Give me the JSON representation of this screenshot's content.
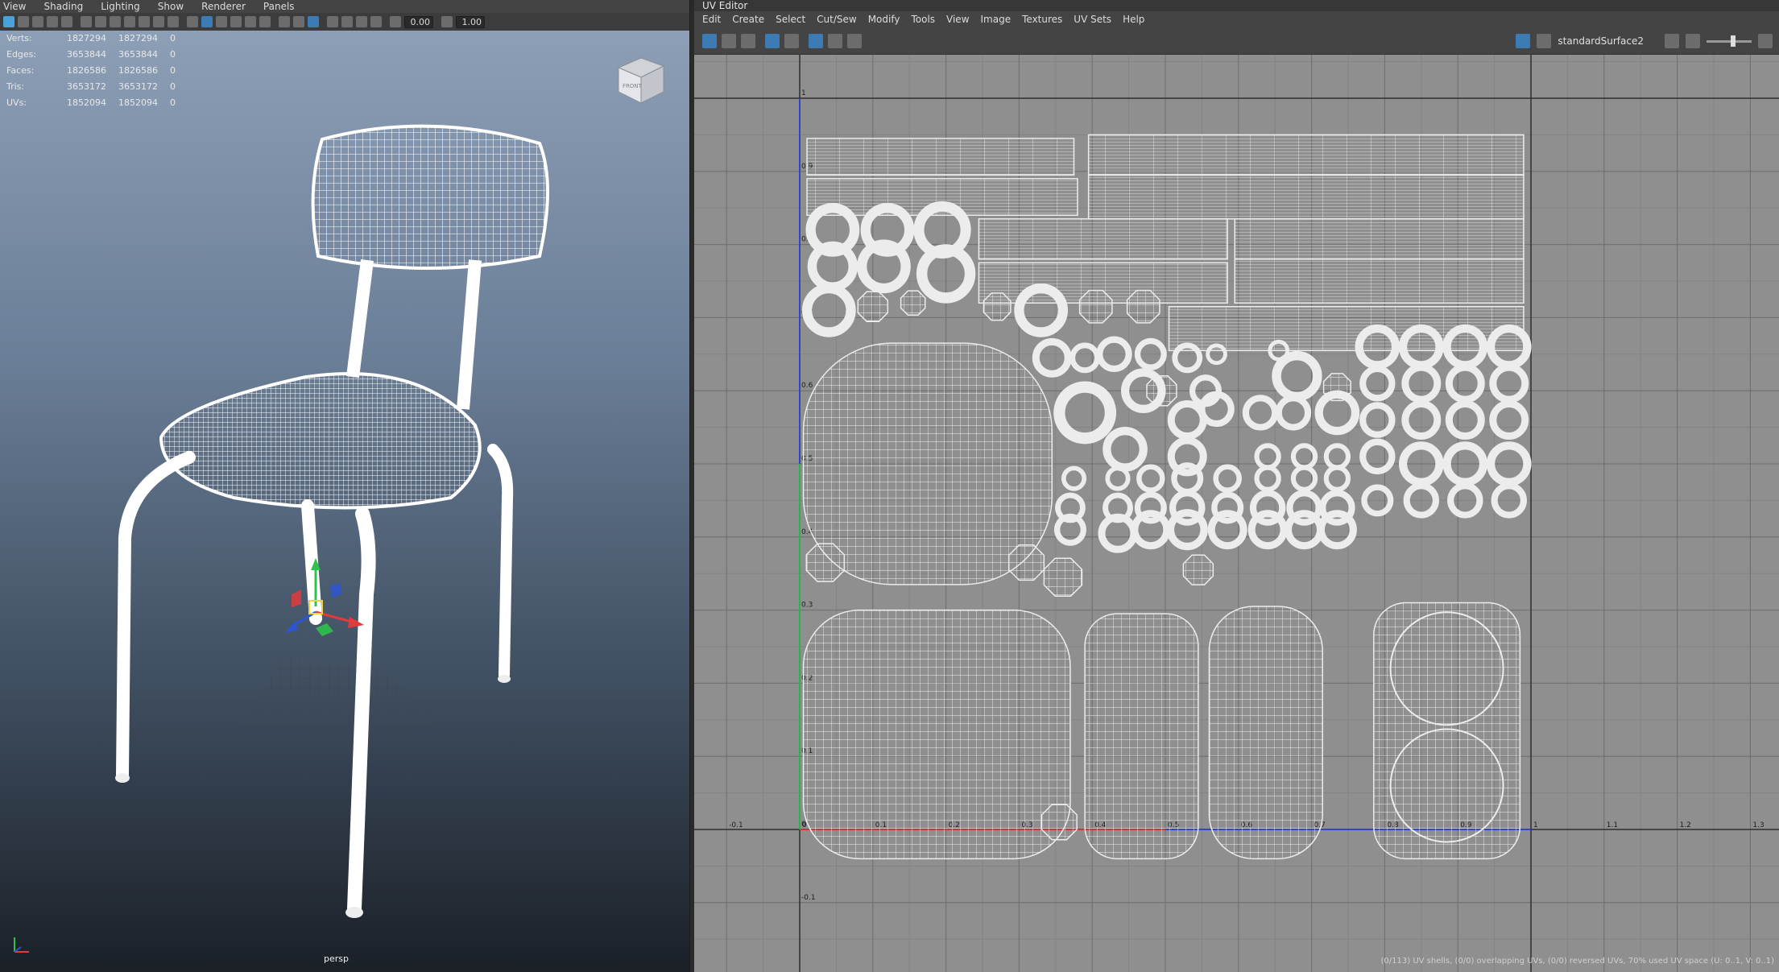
{
  "viewport": {
    "menu": [
      "View",
      "Shading",
      "Lighting",
      "Show",
      "Renderer",
      "Panels"
    ],
    "toolbar": {
      "field_a": "0.00",
      "field_b": "1.00"
    },
    "hud": [
      {
        "label": "Verts:",
        "v1": "1827294",
        "v2": "1827294",
        "v3": "0"
      },
      {
        "label": "Edges:",
        "v1": "3653844",
        "v2": "3653844",
        "v3": "0"
      },
      {
        "label": "Faces:",
        "v1": "1826586",
        "v2": "1826586",
        "v3": "0"
      },
      {
        "label": "Tris:",
        "v1": "3653172",
        "v2": "3653172",
        "v3": "0"
      },
      {
        "label": "UVs:",
        "v1": "1852094",
        "v2": "1852094",
        "v3": "0"
      }
    ],
    "viewcube_label": "FRONT",
    "camera_label": "persp",
    "colors": {
      "sky_top": "#8d9fb6",
      "sky_bottom": "#1b2027",
      "wire": "#ffffff",
      "axis_x": "#e23b3b",
      "axis_y": "#2fc14d",
      "axis_z": "#2c55d6",
      "manip_center": "#f2d33c"
    }
  },
  "uv_editor": {
    "title": "UV Editor",
    "menu": [
      "Edit",
      "Create",
      "Select",
      "Cut/Sew",
      "Modify",
      "Tools",
      "View",
      "Image",
      "Textures",
      "UV Sets",
      "Help"
    ],
    "shader_name": "standardSurface2",
    "u_ticks": [
      "-0.1",
      "0",
      "0.1",
      "0.2",
      "0.3",
      "0.4",
      "0.5",
      "0.6",
      "0.7",
      "0.8",
      "0.9",
      "1",
      "1.1",
      "1.2",
      "1.3"
    ],
    "v_ticks": [
      "1",
      "0.9",
      "0.8",
      "0.7",
      "0.6",
      "0.5",
      "0.4",
      "0.3",
      "0.2",
      "0.1",
      "0",
      "-0.1"
    ],
    "status": "(0/113) UV shells, (0/0) overlapping UVs, (0/0) reversed UVs, 70% used UV space (U: 0..1, V: 0..1)",
    "colors": {
      "background": "#8f8f8f",
      "grid": "#7d7d7d",
      "grid_dark": "#2e2e2e",
      "u_axis": "#c23a3a",
      "v_axis": "#27b54a",
      "shell": "#ececec"
    }
  }
}
